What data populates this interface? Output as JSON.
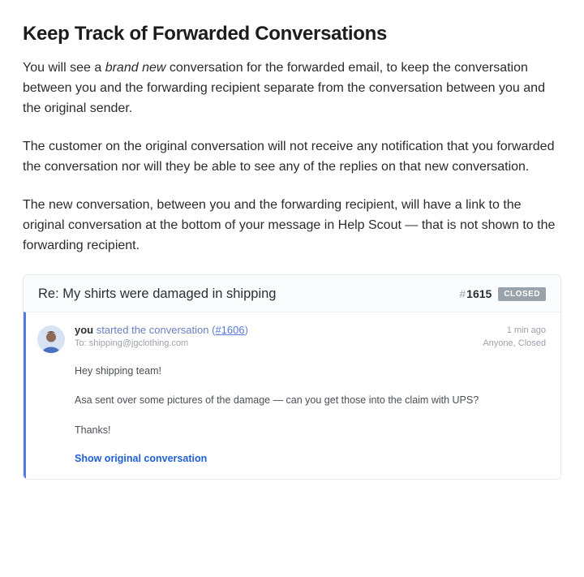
{
  "heading": "Keep Track of Forwarded Conversations",
  "p1_prefix": "You will see a ",
  "p1_em": "brand new",
  "p1_suffix": " conversation for the forwarded email, to keep the conversation between you and the forwarding recipient separate from the conversation between you and the original sender.",
  "p2": "The customer on the original conversation will not receive any notification that you forwarded the conversation nor will they be able to see any of the replies on that new conversation.",
  "p3": "The new conversation, between you and the forwarding recipient, will have a link to the original conversation at the bottom of your message in Help Scout — that is not shown to the forwarding recipient.",
  "card": {
    "subject": "Re: My shirts were damaged in shipping",
    "ticket_hash": "#",
    "ticket_number": "1615",
    "status": "CLOSED",
    "thread": {
      "you_label": "you",
      "started_text": " started the conversation (",
      "link_hash": "#",
      "link_id": "1606",
      "started_close": ")",
      "to_label": "To:",
      "to_email": "shipping@jgclothing.com",
      "time": "1 min ago",
      "assign": "Anyone, Closed",
      "body_l1": "Hey shipping team!",
      "body_l2": "Asa sent over some pictures of the damage — can you get those into the claim with UPS?",
      "body_l3": "Thanks!",
      "show_original": "Show original conversation"
    }
  }
}
